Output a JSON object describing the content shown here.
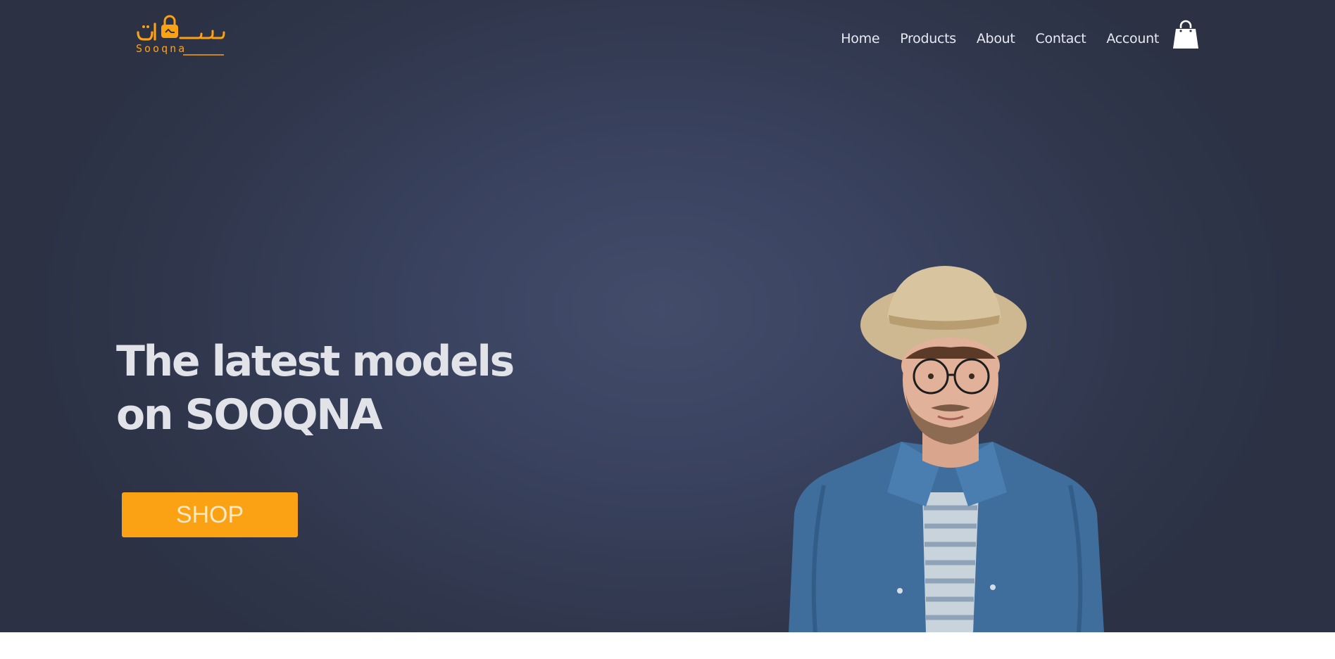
{
  "brand": {
    "name_arabic": "سوقنا",
    "name_latin": "Sooqna",
    "color": "#fba114"
  },
  "nav": {
    "items": [
      {
        "label": "Home"
      },
      {
        "label": "Products"
      },
      {
        "label": "About"
      },
      {
        "label": "Contact"
      },
      {
        "label": "Account"
      }
    ],
    "cart_icon": "shopping-bag-icon"
  },
  "hero": {
    "headline_line1": "The latest models",
    "headline_line2": "on SOOQNA",
    "button_label": "SHOP",
    "image_alt": "man-in-straw-hat-and-denim-shirt"
  },
  "colors": {
    "background": "#363d54",
    "accent": "#fba114",
    "text": "#e2e3e8"
  }
}
